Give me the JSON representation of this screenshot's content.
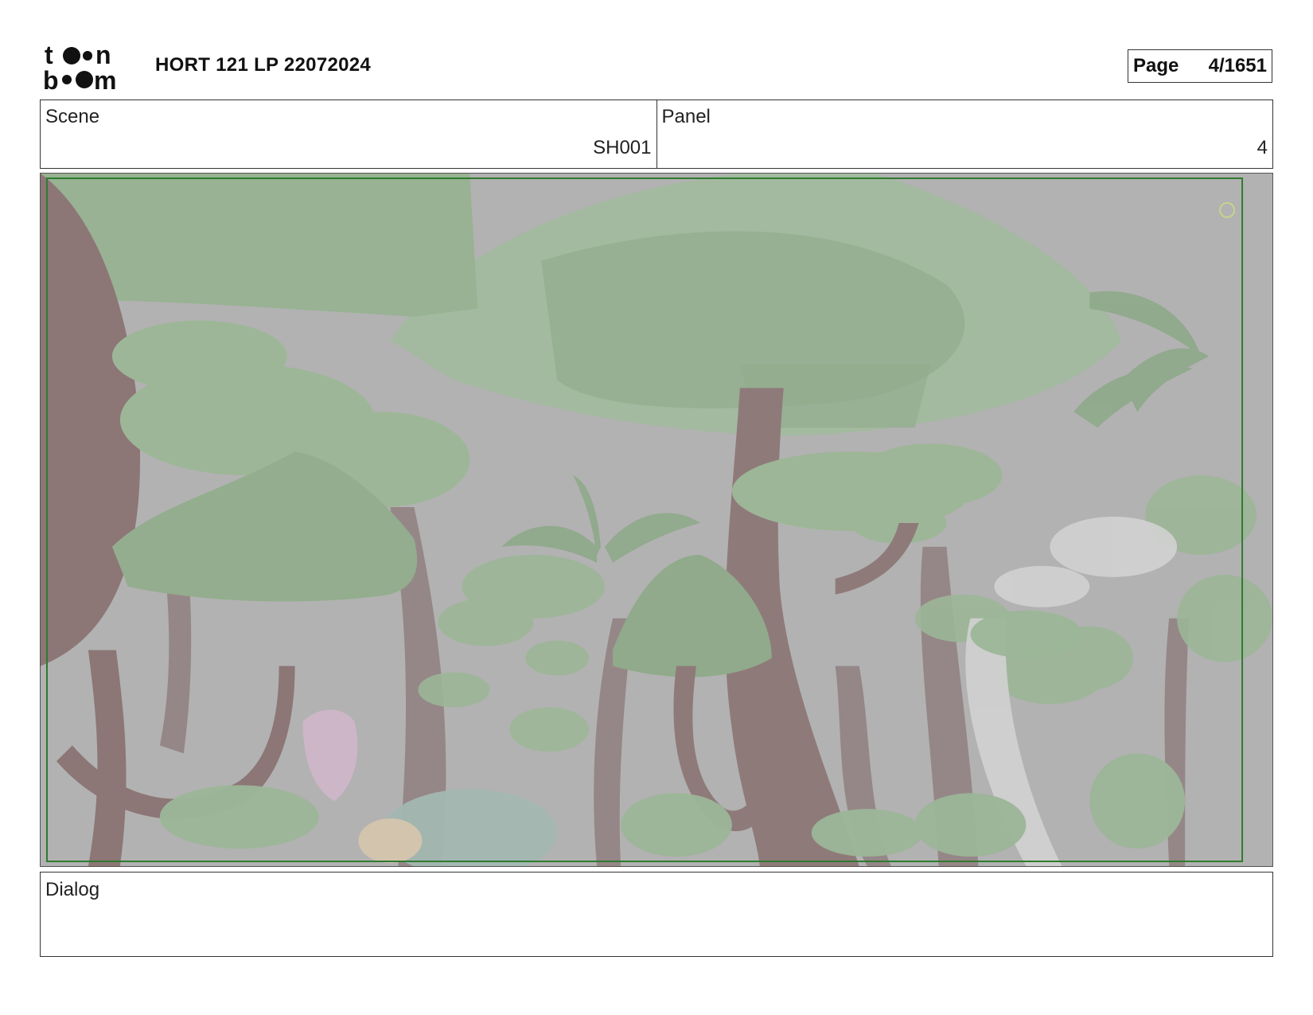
{
  "header": {
    "logo_text": "toon boom",
    "title": "HORT 121 LP 22072024",
    "page_label": "Page",
    "page_value": "4/1651"
  },
  "info": {
    "scene_label": "Scene",
    "scene_value": "SH001",
    "panel_label": "Panel",
    "panel_value": "4"
  },
  "panel": {
    "image_subject": "jungle-forest-scene",
    "colors": {
      "background": "#b2b2b2",
      "foliage": "#93ad8e",
      "foliage_light": "#a6bea0",
      "trunk": "#8f7a7a",
      "safe_frame": "#2f7a2f"
    }
  },
  "dialog": {
    "label": "Dialog",
    "text": ""
  }
}
